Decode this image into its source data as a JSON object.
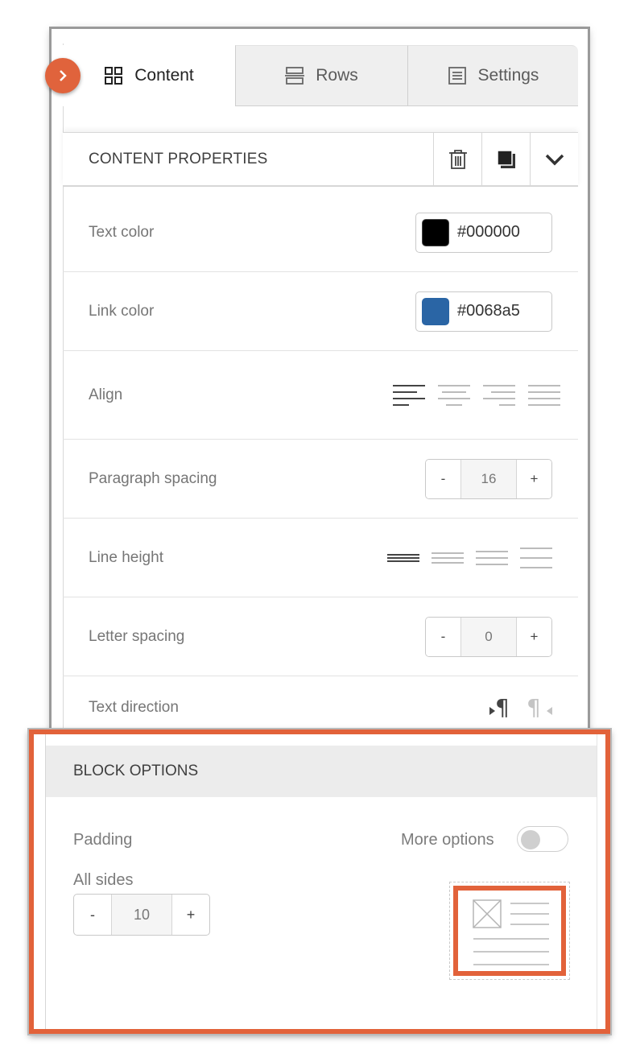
{
  "tabs": [
    {
      "label": "Content",
      "icon": "grid-icon",
      "active": true
    },
    {
      "label": "Rows",
      "icon": "rows-icon",
      "active": false
    },
    {
      "label": "Settings",
      "icon": "settings-list-icon",
      "active": false
    }
  ],
  "content_properties": {
    "title": "CONTENT PROPERTIES",
    "actions": [
      "trash-icon",
      "duplicate-icon",
      "chevron-down-icon"
    ]
  },
  "properties": {
    "text_color": {
      "label": "Text color",
      "value": "#000000",
      "swatch": "#000000"
    },
    "link_color": {
      "label": "Link color",
      "value": "#0068a5",
      "swatch": "#2a65a5"
    },
    "align": {
      "label": "Align",
      "options": [
        "align-left-icon",
        "align-center-icon",
        "align-right-icon",
        "align-justify-icon"
      ],
      "selected": "align-left-icon"
    },
    "paragraph_spacing": {
      "label": "Paragraph spacing",
      "minus": "-",
      "value": "16",
      "plus": "+"
    },
    "line_height": {
      "label": "Line height",
      "options": [
        "line-height-compact-icon",
        "line-height-small-icon",
        "line-height-medium-icon",
        "line-height-large-icon"
      ],
      "selected": "line-height-compact-icon"
    },
    "letter_spacing": {
      "label": "Letter spacing",
      "minus": "-",
      "value": "0",
      "plus": "+"
    },
    "text_direction": {
      "label": "Text direction",
      "options": [
        "ltr-icon",
        "rtl-icon"
      ],
      "selected": "ltr-icon"
    }
  },
  "block_options": {
    "title": "BLOCK OPTIONS",
    "padding_label": "Padding",
    "more_options_label": "More options",
    "more_options_enabled": false,
    "all_sides_label": "All sides",
    "padding": {
      "minus": "-",
      "value": "10",
      "plus": "+"
    }
  },
  "colors": {
    "accent": "#e2623a",
    "highlight_border": "#e2623a"
  }
}
